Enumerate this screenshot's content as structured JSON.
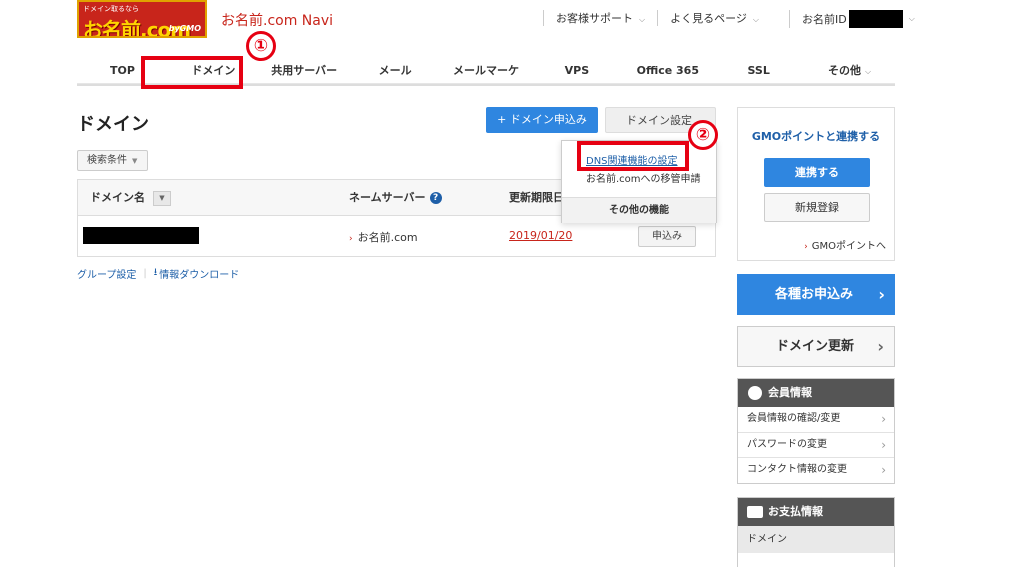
{
  "header": {
    "logo_small": "ドメイン取るなら",
    "logo_big": "お名前.com",
    "logo_gmo": "byGMO",
    "title": "お名前.com Navi",
    "links": [
      {
        "label": "お客様サポート"
      },
      {
        "label": "よく見るページ"
      }
    ],
    "user_label": "お名前ID"
  },
  "nav": {
    "items": [
      {
        "label": "TOP",
        "caret": false
      },
      {
        "label": "ドメイン",
        "caret": false
      },
      {
        "label": "共用サーバー",
        "caret": false
      },
      {
        "label": "メール",
        "caret": false
      },
      {
        "label": "メールマーケ",
        "caret": false
      },
      {
        "label": "VPS",
        "caret": false
      },
      {
        "label": "Office 365",
        "caret": false
      },
      {
        "label": "SSL",
        "caret": false
      },
      {
        "label": "その他",
        "caret": true
      }
    ]
  },
  "annotations": {
    "marker1": "①",
    "marker2": "②",
    "highlight_color": "#e60012"
  },
  "main": {
    "title": "ドメイン",
    "apply_button": "+ ドメイン申込み",
    "settings_button": "ドメイン設定",
    "filter_button": "検索条件",
    "table": {
      "headers": {
        "domain": "ドメイン名",
        "nameserver": "ネームサーバー",
        "expiry": "更新期限日"
      },
      "rows": [
        {
          "domain": "",
          "nameserver": "お名前.com",
          "expiry": "2019/01/20",
          "action": "申込み"
        }
      ]
    },
    "links": {
      "group": "グループ設定",
      "download": "情報ダウンロード"
    }
  },
  "dropdown": {
    "item1": "DNS関連機能の設定",
    "item2": "お名前.comへの移管申請",
    "footer": "その他の機能"
  },
  "sidebar": {
    "gmo": {
      "title": "GMOポイントと連携する",
      "link_button": "連携する",
      "register_button": "新規登録",
      "points_link": "GMOポイントへ"
    },
    "apply_all": "各種お申込み",
    "renew": "ドメイン更新",
    "member": {
      "title": "会員情報",
      "items": [
        "会員情報の確認/変更",
        "パスワードの変更",
        "コンタクト情報の変更"
      ]
    },
    "payment": {
      "title": "お支払情報",
      "sub": "ドメイン"
    }
  },
  "colors": {
    "brand_red": "#c8251b",
    "primary_blue": "#2f86e0",
    "link_blue": "#1e5fa8"
  }
}
